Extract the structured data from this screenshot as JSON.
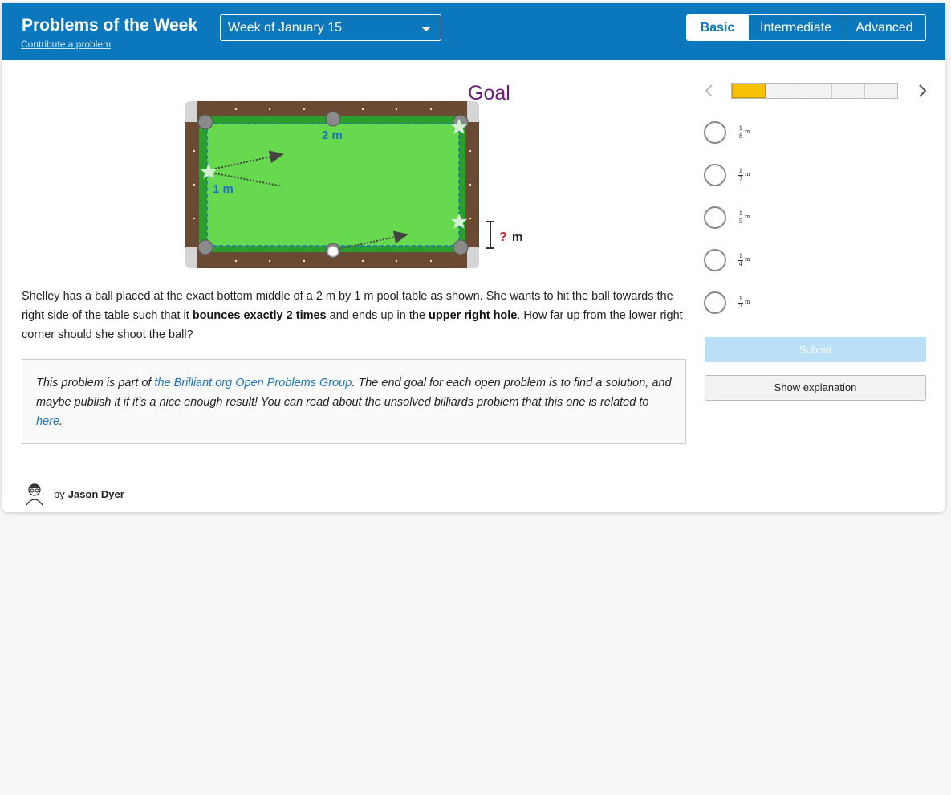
{
  "header": {
    "title": "Problems of the Week",
    "contribute_link": "Contribute a problem",
    "week_select": "Week of January 15",
    "levels": [
      "Basic",
      "Intermediate",
      "Advanced"
    ],
    "active_level": "Basic"
  },
  "diagram": {
    "goal_label": "Goal",
    "width_label": "2 m",
    "height_label": "1 m",
    "question_mark": "?",
    "question_unit": "m"
  },
  "problem": {
    "text_1": "Shelley has a ball placed at the exact bottom middle of a 2 m by 1 m pool table as shown. She wants to hit the ball towards the right side of the table such that it ",
    "bold_1": "bounces exactly 2 times",
    "text_2": " and ends up in the ",
    "bold_2": "upper right hole",
    "text_3": ". How far up from the lower right corner should she shoot the ball?"
  },
  "note": {
    "text_1": "This problem is part of ",
    "link_1": "the Brilliant.org Open Problems Group",
    "text_2": ". The end goal for each open problem is to find a solution, and maybe publish it if it's a nice enough result! You can read about the unsolved billiards problem that this one is related to ",
    "link_2": "here",
    "text_3": "."
  },
  "author": {
    "by": "by",
    "name": "Jason Dyer"
  },
  "quiz": {
    "progress": {
      "total": 5,
      "completed": 1
    },
    "options": [
      {
        "num": "1",
        "den": "8",
        "unit": "m"
      },
      {
        "num": "1",
        "den": "7",
        "unit": "m"
      },
      {
        "num": "1",
        "den": "5",
        "unit": "m"
      },
      {
        "num": "1",
        "den": "4",
        "unit": "m"
      },
      {
        "num": "1",
        "den": "3",
        "unit": "m"
      }
    ],
    "submit_label": "Submit",
    "explain_label": "Show explanation"
  },
  "colors": {
    "header_bg": "#0b77bd",
    "felt": "#66d94e",
    "rail": "#6b4a34",
    "goal": "#6a1b7e",
    "accent_blue": "#1a73c4",
    "question_red": "#d01a1a",
    "progress_done": "#f6c200"
  }
}
